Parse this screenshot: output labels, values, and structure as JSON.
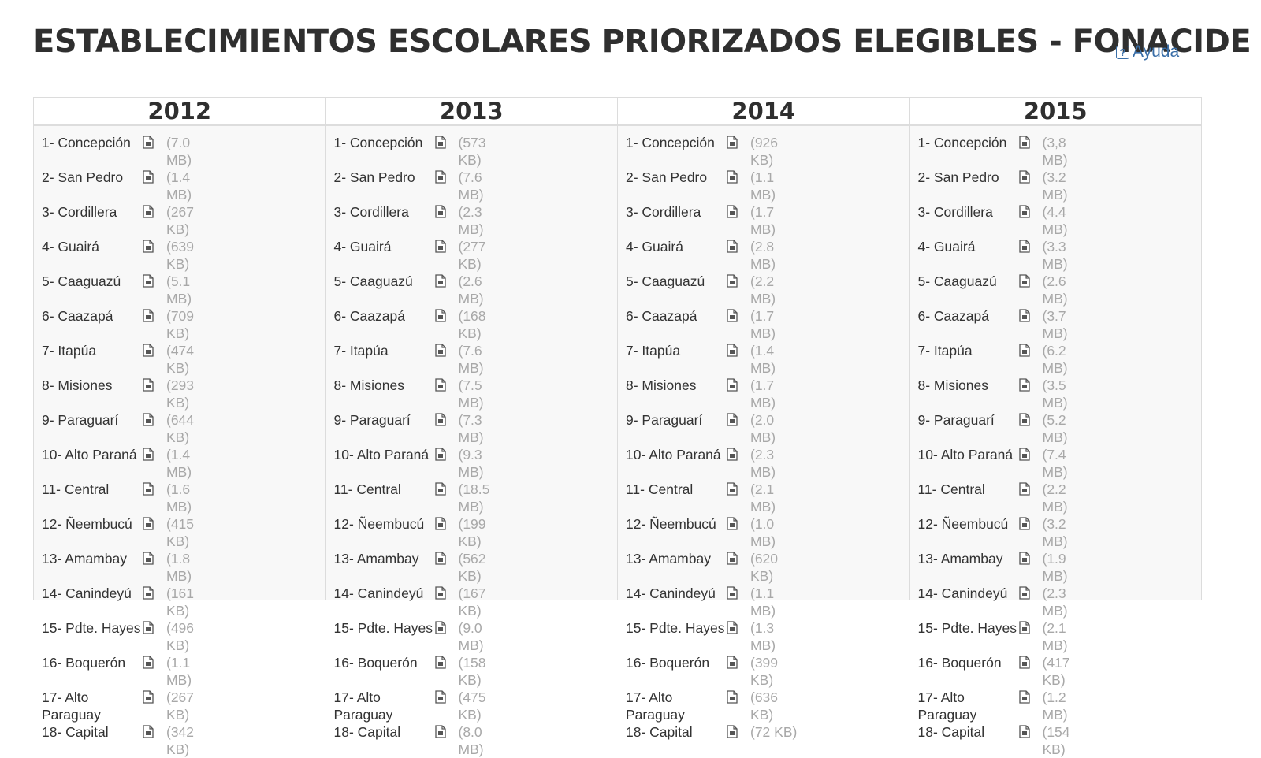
{
  "header": {
    "title": "ESTABLECIMIENTOS ESCOLARES PRIORIZADOS ELEGIBLES - FONACIDE",
    "help_label": "Ayuda",
    "help_icon": "question-box-icon"
  },
  "colors": {
    "link": "#3a6fa8",
    "muted": "#a8a8a8",
    "border": "#dcdcdc"
  },
  "file_icon": "document-icon",
  "years": [
    {
      "year": "2012",
      "items": [
        {
          "name": "1- Concepción",
          "size": "(7.0 MB)"
        },
        {
          "name": "2- San Pedro",
          "size": "(1.4 MB)"
        },
        {
          "name": "3- Cordillera",
          "size": "(267 KB)"
        },
        {
          "name": "4- Guairá",
          "size": "(639 KB)"
        },
        {
          "name": "5- Caaguazú",
          "size": "(5.1 MB)"
        },
        {
          "name": "6- Caazapá",
          "size": "(709 KB)"
        },
        {
          "name": "7- Itapúa",
          "size": "(474 KB)"
        },
        {
          "name": "8- Misiones",
          "size": "(293 KB)"
        },
        {
          "name": "9- Paraguarí",
          "size": "(644 KB)"
        },
        {
          "name": "10- Alto Paraná",
          "size": "(1.4 MB)"
        },
        {
          "name": "11- Central",
          "size": "(1.6 MB)"
        },
        {
          "name": "12- Ñeembucú",
          "size": "(415 KB)"
        },
        {
          "name": "13- Amambay",
          "size": "(1.8 MB)"
        },
        {
          "name": "14- Canindeyú",
          "size": "(161 KB)"
        },
        {
          "name": "15- Pdte. Hayes",
          "size": "(496 KB)"
        },
        {
          "name": "16- Boquerón",
          "size": "(1.1 MB)"
        },
        {
          "name": "17- Alto Paraguay",
          "size": "(267 KB)"
        },
        {
          "name": "18- Capital",
          "size": "(342 KB)"
        }
      ]
    },
    {
      "year": "2013",
      "items": [
        {
          "name": "1- Concepción",
          "size": "(573 KB)"
        },
        {
          "name": "2- San Pedro",
          "size": "(7.6 MB)"
        },
        {
          "name": "3- Cordillera",
          "size": "(2.3 MB)"
        },
        {
          "name": "4- Guairá",
          "size": "(277 KB)"
        },
        {
          "name": "5- Caaguazú",
          "size": "(2.6 MB)"
        },
        {
          "name": "6- Caazapá",
          "size": "(168 KB)"
        },
        {
          "name": "7- Itapúa",
          "size": "(7.6 MB)"
        },
        {
          "name": "8- Misiones",
          "size": "(7.5 MB)"
        },
        {
          "name": "9- Paraguarí",
          "size": "(7.3 MB)"
        },
        {
          "name": "10- Alto Paraná",
          "size": "(9.3 MB)"
        },
        {
          "name": "11- Central",
          "size": "(18.5 MB)"
        },
        {
          "name": "12- Ñeembucú",
          "size": "(199 KB)"
        },
        {
          "name": "13- Amambay",
          "size": "(562 KB)"
        },
        {
          "name": "14- Canindeyú",
          "size": "(167 KB)"
        },
        {
          "name": "15- Pdte. Hayes",
          "size": "(9.0 MB)"
        },
        {
          "name": "16- Boquerón",
          "size": "(158 KB)"
        },
        {
          "name": "17- Alto Paraguay",
          "size": "(475 KB)"
        },
        {
          "name": "18- Capital",
          "size": "(8.0 MB)"
        }
      ]
    },
    {
      "year": "2014",
      "items": [
        {
          "name": "1- Concepción",
          "size": "(926 KB)"
        },
        {
          "name": "2- San Pedro",
          "size": "(1.1 MB)"
        },
        {
          "name": "3- Cordillera",
          "size": "(1.7 MB)"
        },
        {
          "name": "4- Guairá",
          "size": "(2.8 MB)"
        },
        {
          "name": "5- Caaguazú",
          "size": "(2.2 MB)"
        },
        {
          "name": "6- Caazapá",
          "size": "(1.7 MB)"
        },
        {
          "name": "7- Itapúa",
          "size": "(1.4 MB)"
        },
        {
          "name": "8- Misiones",
          "size": "(1.7 MB)"
        },
        {
          "name": "9- Paraguarí",
          "size": "(2.0 MB)"
        },
        {
          "name": "10- Alto Paraná",
          "size": "(2.3 MB)"
        },
        {
          "name": "11- Central",
          "size": "(2.1 MB)"
        },
        {
          "name": "12- Ñeembucú",
          "size": "(1.0 MB)"
        },
        {
          "name": "13- Amambay",
          "size": "(620 KB)"
        },
        {
          "name": "14- Canindeyú",
          "size": "(1.1 MB)"
        },
        {
          "name": "15- Pdte. Hayes",
          "size": "(1.3 MB)"
        },
        {
          "name": "16- Boquerón",
          "size": "(399 KB)"
        },
        {
          "name": "17- Alto Paraguay",
          "size": "(636 KB)"
        },
        {
          "name": "18- Capital",
          "size": "(72 KB)"
        }
      ]
    },
    {
      "year": "2015",
      "items": [
        {
          "name": "1- Concepción",
          "size": "(3,8 MB)"
        },
        {
          "name": "2- San Pedro",
          "size": "(3.2 MB)"
        },
        {
          "name": "3- Cordillera",
          "size": "(4.4 MB)"
        },
        {
          "name": "4- Guairá",
          "size": "(3.3 MB)"
        },
        {
          "name": "5- Caaguazú",
          "size": "(2.6 MB)"
        },
        {
          "name": "6- Caazapá",
          "size": "(3.7 MB)"
        },
        {
          "name": "7- Itapúa",
          "size": "(6.2 MB)"
        },
        {
          "name": "8- Misiones",
          "size": "(3.5 MB)"
        },
        {
          "name": "9- Paraguarí",
          "size": "(5.2 MB)"
        },
        {
          "name": "10- Alto Paraná",
          "size": "(7.4 MB)"
        },
        {
          "name": "11- Central",
          "size": "(2.2 MB)"
        },
        {
          "name": "12- Ñeembucú",
          "size": "(3.2 MB)"
        },
        {
          "name": "13- Amambay",
          "size": "(1.9 MB)"
        },
        {
          "name": "14- Canindeyú",
          "size": "(2.3 MB)"
        },
        {
          "name": "15- Pdte. Hayes",
          "size": "(2.1 MB)"
        },
        {
          "name": "16- Boquerón",
          "size": "(417 KB)"
        },
        {
          "name": "17- Alto Paraguay",
          "size": "(1.2 MB)"
        },
        {
          "name": "18- Capital",
          "size": "(154 KB)"
        }
      ]
    }
  ]
}
